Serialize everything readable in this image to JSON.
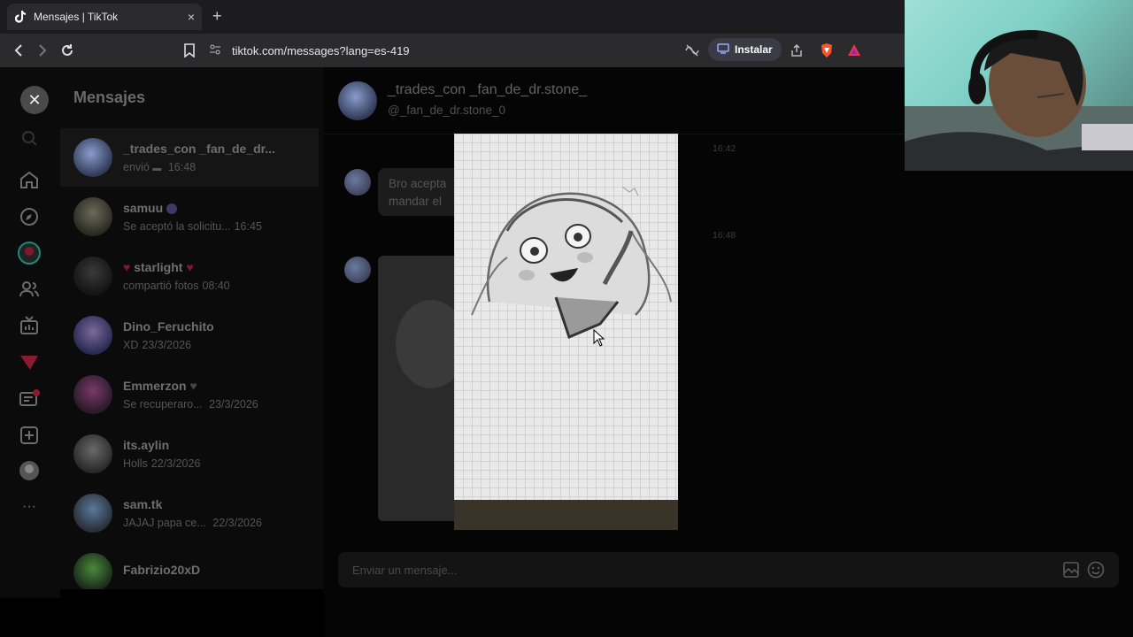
{
  "browser": {
    "tab_title": "Mensajes | TikTok",
    "tab_close": "×",
    "new_tab": "+",
    "url": "tiktok.com/messages?lang=es-419",
    "install_label": "Instalar"
  },
  "sidebar": {
    "title": "Mensajes",
    "conversations": [
      {
        "name": "_trades_con _fan_de_dr...",
        "preview": "envió",
        "time": "16:48",
        "active": true
      },
      {
        "name": "samuu",
        "preview": "Se aceptó la solicitu...",
        "time": "16:45"
      },
      {
        "name": "starlight",
        "preview": "compartió fotos",
        "time": "08:40"
      },
      {
        "name": "Dino_Feruchito",
        "preview": "XD",
        "time": "23/3/2026"
      },
      {
        "name": "Emmerzon",
        "preview": "Se recuperaro...",
        "time": "23/3/2026"
      },
      {
        "name": "its.aylin",
        "preview": "Holls",
        "time": "22/3/2026"
      },
      {
        "name": "sam.tk",
        "preview": "JAJAJ papa ce...",
        "time": "22/3/2026"
      },
      {
        "name": "Fabrizio20xD",
        "preview": "",
        "time": ""
      }
    ]
  },
  "chat": {
    "name": "_trades_con _fan_de_dr.stone_",
    "handle": "@_fan_de_dr.stone_0",
    "timestamp1": "16:42",
    "timestamp2": "16:48",
    "message1": "Bro acepta mandar el",
    "composer_placeholder": "Enviar un mensaje..."
  },
  "colors": {
    "accent": "#3b3b46",
    "brand_red": "#fe2c55"
  }
}
